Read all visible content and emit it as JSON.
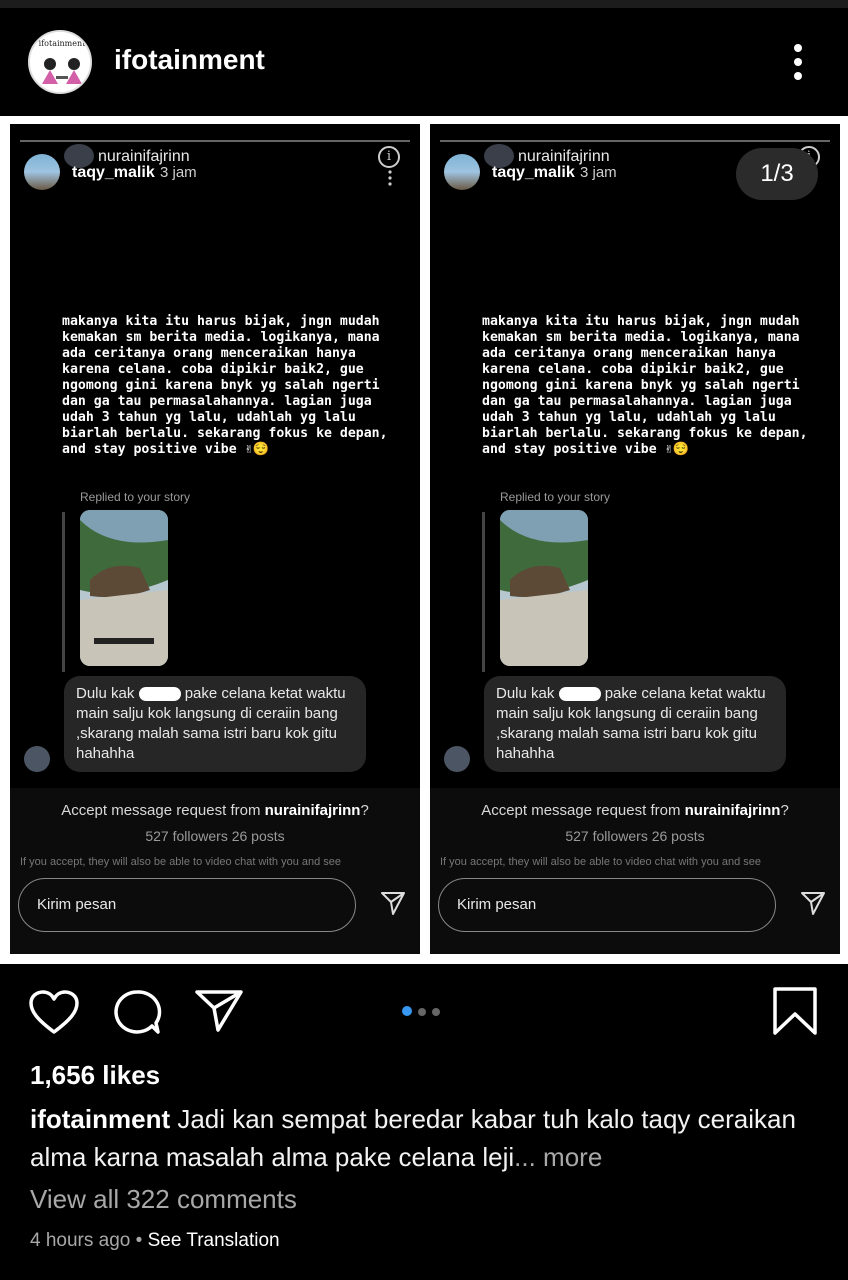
{
  "header": {
    "username": "ifotainment",
    "menu_icon": "more-vertical-icon"
  },
  "story": {
    "counter": "1/3",
    "panels": [
      {
        "sender_name": "nurainifajrinn",
        "author": "taqy_malik",
        "time": "3 jam",
        "text": "makanya kita itu harus bijak, jngn mudah\nkemakan sm berita media. logikanya, mana\nada ceritanya orang menceraikan hanya\nkarena celana. coba dipikir baik2, gue\nngomong gini karena bnyk yg salah ngerti\ndan ga tau permasalahannya. lagian juga\nudah 3 tahun yg lalu, udahlah yg lalu\nbiarlah berlalu. sekarang fokus ke depan,\nand stay positive vibe ✌😌",
        "replied_label": "Replied to your story",
        "reply_pre": "Dulu kak",
        "reply_post": " pake celana ketat waktu main salju kok langsung di ceraiin bang ,skarang malah sama istri baru kok gitu hahahha",
        "accept_prefix": "Accept message request from ",
        "accept_user": "nurainifajrinn",
        "accept_suffix": "?",
        "stats": "527 followers 26 posts",
        "note": "If you accept, they will also be able to video chat with you and see",
        "input_placeholder": "Kirim pesan"
      },
      {
        "sender_name": "nurainifajrinn",
        "author": "taqy_malik",
        "time": "3 jam",
        "text": "makanya kita itu harus bijak, jngn mudah\nkemakan sm berita media. logikanya, mana\nada ceritanya orang menceraikan hanya\nkarena celana. coba dipikir baik2, gue\nngomong gini karena bnyk yg salah ngerti\ndan ga tau permasalahannya. lagian juga\nudah 3 tahun yg lalu, udahlah yg lalu\nbiarlah berlalu. sekarang fokus ke depan,\nand stay positive vibe ✌😌",
        "replied_label": "Replied to your story",
        "reply_pre": "Dulu kak",
        "reply_post": " pake celana ketat waktu main salju kok langsung di ceraiin bang ,skarang malah sama istri baru kok gitu hahahha",
        "accept_prefix": "Accept message request from ",
        "accept_user": "nurainifajrinn",
        "accept_suffix": "?",
        "stats": "527 followers 26 posts",
        "note": "If you accept, they will also be able to video chat with you and see",
        "input_placeholder": "Kirim pesan"
      }
    ]
  },
  "actions": {
    "like_icon": "heart-icon",
    "comment_icon": "comment-icon",
    "share_icon": "send-icon",
    "save_icon": "bookmark-icon",
    "carousel_total": 3,
    "carousel_active": 1,
    "accent_color": "#3897f0"
  },
  "post": {
    "likes": "1,656 likes",
    "caption_user": "ifotainment",
    "caption_text": " Jadi kan sempat beredar kabar tuh kalo taqy ceraikan alma karna masalah alma pake celana leji",
    "caption_more": "... more",
    "view_comments": "View all 322 comments",
    "time_ago": "4 hours ago",
    "separator": " • ",
    "see_translation": "See Translation"
  }
}
